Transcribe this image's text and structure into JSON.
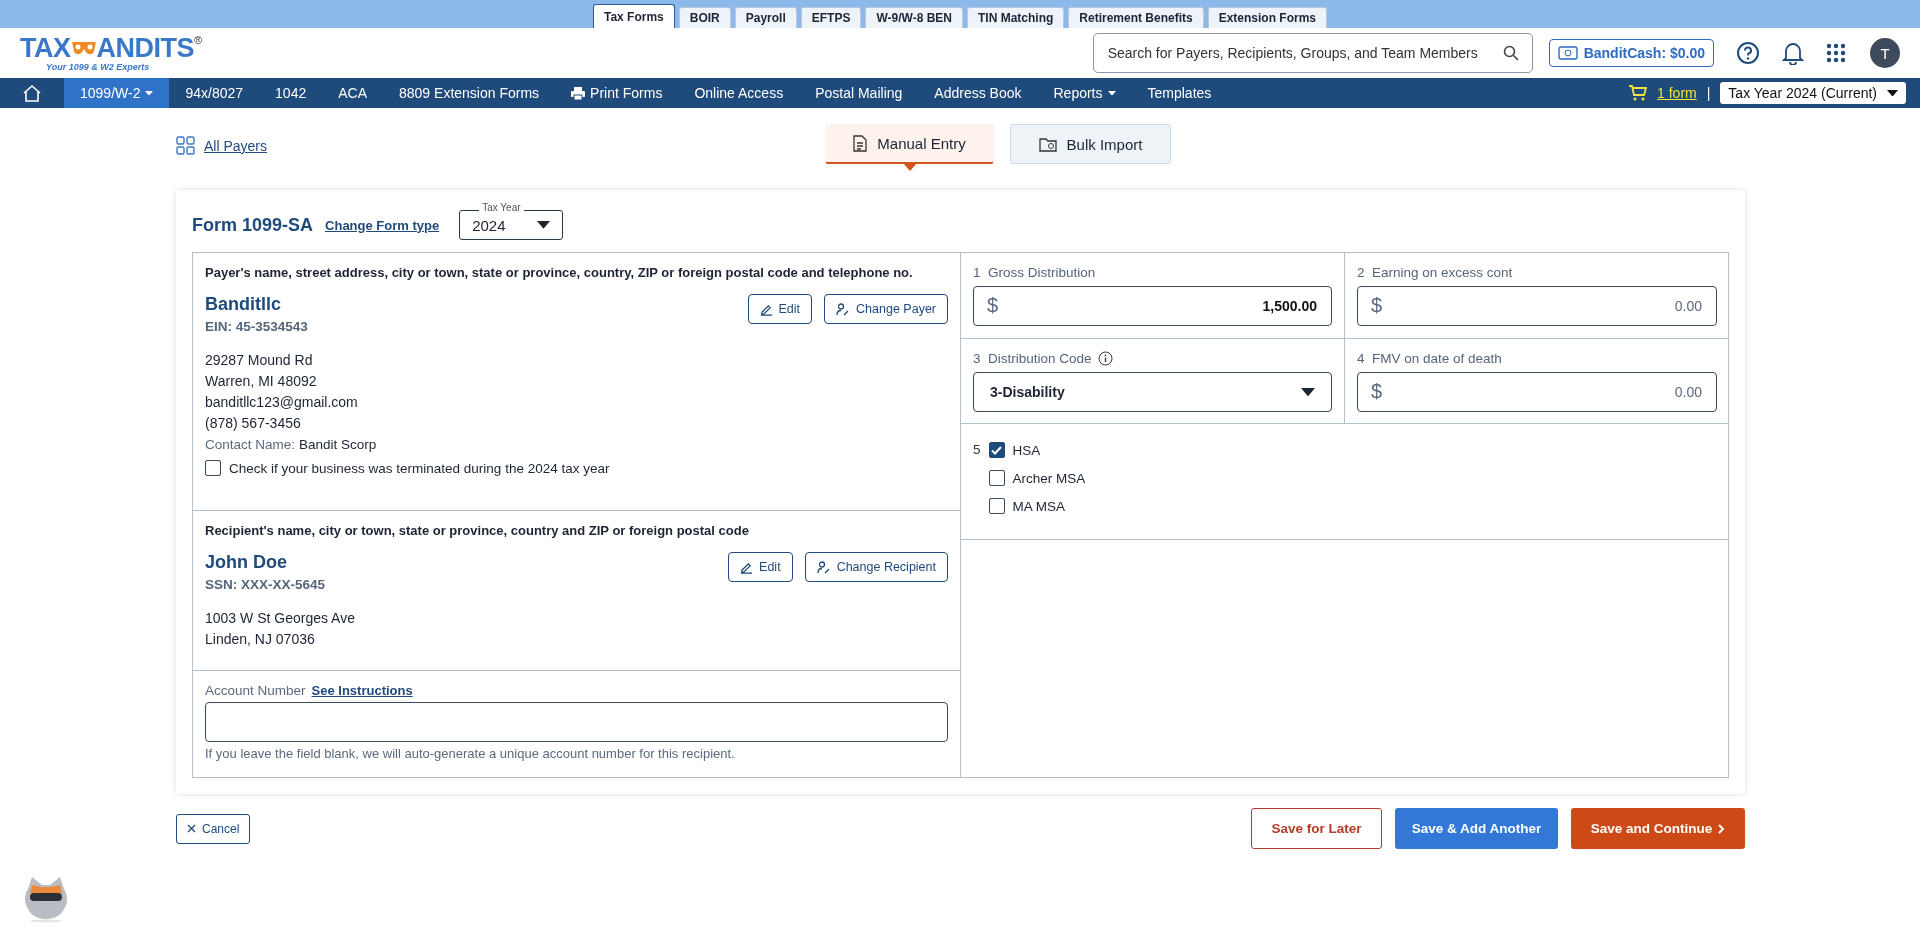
{
  "top_tabs": [
    {
      "label": "Tax Forms",
      "selected": true
    },
    {
      "label": "BOIR",
      "selected": false
    },
    {
      "label": "Payroll",
      "selected": false
    },
    {
      "label": "EFTPS",
      "selected": false
    },
    {
      "label": "W-9/W-8 BEN",
      "selected": false
    },
    {
      "label": "TIN Matching",
      "selected": false
    },
    {
      "label": "Retirement Benefits",
      "selected": false
    },
    {
      "label": "Extension Forms",
      "selected": false
    }
  ],
  "logo": {
    "left": "TAX",
    "right": "ANDITS",
    "mark": "®",
    "tagline": "Your 1099 & W2 Experts"
  },
  "search": {
    "placeholder": "Search for Payers, Recipients, Groups, and Team Members"
  },
  "bandit_cash": "BanditCash: $0.00",
  "avatar": "T",
  "nav": [
    {
      "label": "1099/W-2",
      "kind": "dropdown",
      "selected": true
    },
    {
      "label": "94x/8027",
      "kind": "plain",
      "selected": false
    },
    {
      "label": "1042",
      "kind": "plain",
      "selected": false
    },
    {
      "label": "ACA",
      "kind": "plain",
      "selected": false
    },
    {
      "label": "8809 Extension Forms",
      "kind": "plain",
      "selected": false
    },
    {
      "label": "Print Forms",
      "kind": "print",
      "selected": false
    },
    {
      "label": "Online Access",
      "kind": "plain",
      "selected": false
    },
    {
      "label": "Postal Mailing",
      "kind": "plain",
      "selected": false
    },
    {
      "label": "Address Book",
      "kind": "plain",
      "selected": false
    },
    {
      "label": "Reports",
      "kind": "dropdown",
      "selected": false
    },
    {
      "label": "Templates",
      "kind": "plain",
      "selected": false
    }
  ],
  "cart": "1 form",
  "cart_separator": "|",
  "tax_year_select": "Tax Year 2024 (Current)",
  "all_payers": "All Payers",
  "entry_modes": [
    {
      "label": "Manual Entry",
      "kind": "document",
      "selected": true
    },
    {
      "label": "Bulk Import",
      "kind": "folder",
      "selected": false
    }
  ],
  "form": {
    "title": "Form 1099-SA",
    "change_link": "Change Form type",
    "tax_year": {
      "label": "Tax Year",
      "value": "2024"
    }
  },
  "payer": {
    "heading": "Payer's name, street address, city or town, state or province, country, ZIP or foreign postal code and telephone no.",
    "name": "Banditllc",
    "id_line": "EIN: 45-3534543",
    "address": [
      "29287 Mound Rd",
      "Warren, MI 48092",
      "banditllc123@gmail.com",
      "(878) 567-3456"
    ],
    "contact_label": "Contact Name:",
    "contact_value": "Bandit Scorp",
    "terminated": {
      "label": "Check if your business was terminated during the 2024 tax year",
      "checked": false
    },
    "edit": "Edit",
    "change": "Change Payer"
  },
  "recipient": {
    "heading": "Recipient's name, city or town, state or province, country and ZIP or foreign postal code",
    "name": "John Doe",
    "id_line": "SSN: XXX-XX-5645",
    "address": [
      "1003 W St Georges Ave",
      "Linden, NJ 07036"
    ],
    "edit": "Edit",
    "change": "Change Recipient"
  },
  "account": {
    "label": "Account Number",
    "link": "See Instructions",
    "hint": "If you leave the field blank, we will auto-generate a unique account number for this recipient."
  },
  "boxes": [
    {
      "number": "1",
      "label": "Gross Distribution",
      "kind": "money",
      "value": "1,500.00"
    },
    {
      "number": "2",
      "label": "Earning on excess cont",
      "kind": "money",
      "placeholder": "0.00"
    },
    {
      "number": "3",
      "label": "Distribution Code",
      "kind": "select",
      "value": "3-Disability",
      "info": true
    },
    {
      "number": "4",
      "label": "FMV on date of death",
      "kind": "money",
      "placeholder": "0.00"
    }
  ],
  "currency": "$",
  "box5": {
    "number": "5",
    "options": [
      {
        "label": "HSA",
        "checked": true
      },
      {
        "label": "Archer MSA",
        "checked": false
      },
      {
        "label": "MA MSA",
        "checked": false
      }
    ]
  },
  "actions": {
    "cancel": "Cancel",
    "save_later": "Save for Later",
    "save_add": "Save & Add Another",
    "save_continue": "Save and Continue"
  }
}
